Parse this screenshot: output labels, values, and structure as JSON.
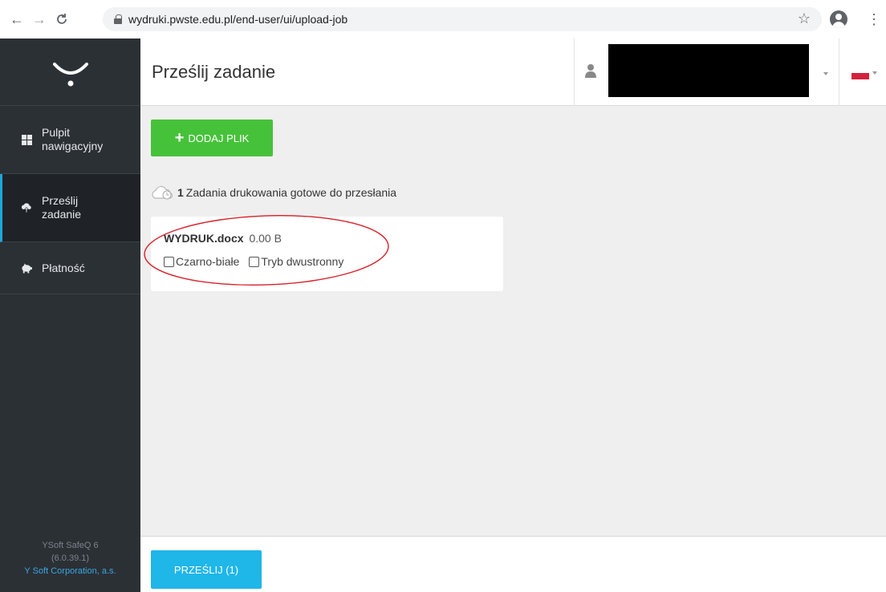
{
  "browser": {
    "url": "wydruki.pwste.edu.pl/end-user/ui/upload-job",
    "back_icon": "arrow-left-icon",
    "forward_icon": "arrow-right-icon",
    "reload_icon": "reload-icon"
  },
  "sidebar": {
    "items": [
      {
        "label_line1": "Pulpit",
        "label_line2": "nawigacyjny",
        "icon": "dashboard-grid-icon"
      },
      {
        "label_line1": "Prześlij",
        "label_line2": "zadanie",
        "icon": "cloud-upload-icon",
        "active": true
      },
      {
        "label": "Płatność",
        "icon": "piggy-bank-icon"
      }
    ],
    "footer": {
      "product": "YSoft SafeQ 6",
      "version": "(6.0.39.1)",
      "company": "Y Soft Corporation, a.s."
    }
  },
  "header": {
    "title": "Prześlij zadanie"
  },
  "main": {
    "add_button_label": "DODAJ PLIK",
    "jobs_count": "1",
    "jobs_text": "Zadania drukowania gotowe do przesłania",
    "job": {
      "filename": "WYDRUK.docx",
      "size": "0.00 B",
      "options": [
        "Czarno-białe",
        "Tryb dwustronny"
      ]
    }
  },
  "footer_bar": {
    "submit_label": "PRZEŚLIJ (1)"
  },
  "colors": {
    "sidebar_bg": "#2b3035",
    "accent_green": "#46c23a",
    "accent_blue": "#1fb6e8",
    "annotation_red": "#d9202a"
  }
}
